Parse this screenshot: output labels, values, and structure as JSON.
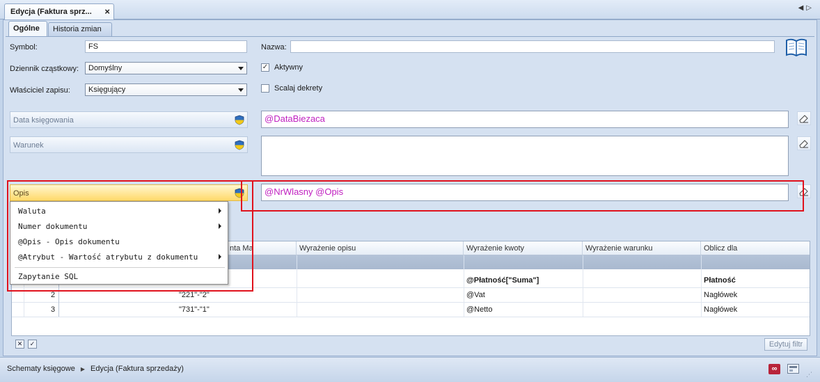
{
  "doc_tab": {
    "title": "Edycja (Faktura sprz..."
  },
  "tabs": [
    {
      "label": "Ogólne"
    },
    {
      "label": "Historia zmian"
    }
  ],
  "form": {
    "symbol_label": "Symbol:",
    "symbol_value": "FS",
    "nazwa_label": "Nazwa:",
    "nazwa_value": "",
    "dziennik_label": "Dziennik cząstkowy:",
    "dziennik_value": "Domyślny",
    "wlasciciel_label": "Właściciel zapisu:",
    "wlasciciel_value": "Księgujący",
    "aktywny_label": "Aktywny",
    "aktywny_checked": true,
    "scalaj_label": "Scalaj dekrety",
    "scalaj_checked": false
  },
  "fields": {
    "data_ksiegowania": {
      "label": "Data księgowania",
      "expr": "@DataBiezaca"
    },
    "warunek": {
      "label": "Warunek",
      "expr": ""
    },
    "opis": {
      "label": "Opis",
      "expr": "@NrWlasny @Opis"
    }
  },
  "grid": {
    "columns": [
      "nta Ma",
      "Wyrażenie opisu",
      "Wyrażenie kwoty",
      "Wyrażenie warunku",
      "Oblicz dla"
    ],
    "rows": [
      {
        "num": "",
        "konto": "",
        "opis": "",
        "kwota": "@Płatność[\"Suma\"]",
        "warunek": "",
        "oblicz": "Płatność"
      },
      {
        "num": "2",
        "konto": "\"221\"-\"2\"",
        "opis": "",
        "kwota": "@Vat",
        "warunek": "",
        "oblicz": "Nagłówek"
      },
      {
        "num": "3",
        "konto": "\"731\"-\"1\"",
        "opis": "",
        "kwota": "@Netto",
        "warunek": "",
        "oblicz": "Nagłówek"
      }
    ],
    "edit_filter_label": "Edytuj filtr"
  },
  "context_menu": {
    "items": [
      {
        "label": "Waluta",
        "submenu": true
      },
      {
        "label": "Numer dokumentu",
        "submenu": true
      },
      {
        "label": "@Opis - Opis dokumentu",
        "submenu": false
      },
      {
        "label": "@Atrybut - Wartość atrybutu z dokumentu",
        "submenu": true
      },
      {
        "label": "Zapytanie SQL",
        "submenu": false
      }
    ]
  },
  "breadcrumb": {
    "items": [
      "Schematy księgowe",
      "Edycja (Faktura sprzedaży)"
    ]
  },
  "colors": {
    "expr_text": "#c020c0",
    "highlight_red": "#e0121d",
    "active_field": "#ffd96a"
  }
}
